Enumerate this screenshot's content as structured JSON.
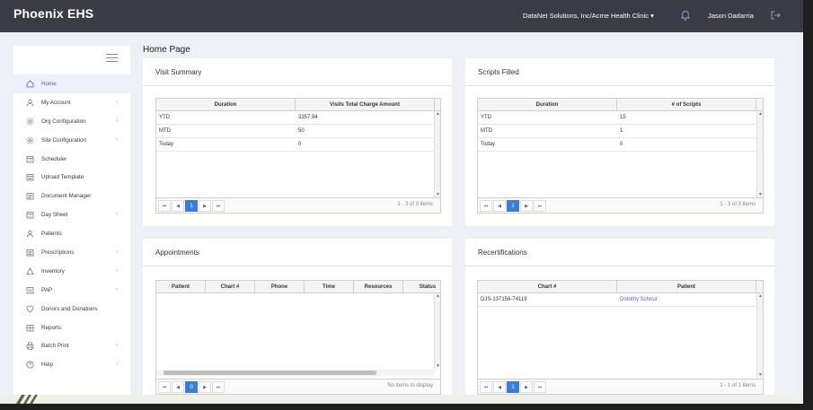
{
  "topbar": {
    "brand": "Phoenix EHS",
    "clinic": "DataNet Solutions, Inc/Acme Health Clinic",
    "user": "Jason Dadarria"
  },
  "sidebar": {
    "items": [
      {
        "label": "Home",
        "icon": "home-icon",
        "chevron": false,
        "active": true
      },
      {
        "label": "My Account",
        "icon": "user-icon",
        "chevron": true
      },
      {
        "label": "Org Configuration",
        "icon": "gear-icon",
        "chevron": true
      },
      {
        "label": "Site Configuration",
        "icon": "gear-icon",
        "chevron": true
      },
      {
        "label": "Scheduler",
        "icon": "calendar-icon",
        "chevron": false
      },
      {
        "label": "Upload Template",
        "icon": "upload-icon",
        "chevron": false
      },
      {
        "label": "Document Manager",
        "icon": "document-icon",
        "chevron": false
      },
      {
        "label": "Day Sheet",
        "icon": "calendar-icon",
        "chevron": true
      },
      {
        "label": "Patients",
        "icon": "patients-icon",
        "chevron": false
      },
      {
        "label": "Prescriptions",
        "icon": "prescription-icon",
        "chevron": true
      },
      {
        "label": "Inventory",
        "icon": "inventory-icon",
        "chevron": true
      },
      {
        "label": "PAP",
        "icon": "pap-icon",
        "chevron": true
      },
      {
        "label": "Donors and Donations",
        "icon": "donation-icon",
        "chevron": false
      },
      {
        "label": "Reports",
        "icon": "reports-icon",
        "chevron": false
      },
      {
        "label": "Batch Print",
        "icon": "print-icon",
        "chevron": true
      },
      {
        "label": "Help",
        "icon": "help-icon",
        "chevron": true
      }
    ]
  },
  "page": {
    "title": "Home Page"
  },
  "visit_summary": {
    "title": "Visit Summary",
    "columns": [
      "Duration",
      "Visits Total Charge Amount"
    ],
    "rows": [
      [
        "YTD",
        "3357.94"
      ],
      [
        "MTD",
        "50"
      ],
      [
        "Today",
        "0"
      ]
    ],
    "page": "1",
    "info": "1 - 3 of 3 items"
  },
  "scripts_filled": {
    "title": "Scripts Filled",
    "columns": [
      "Duration",
      "# of Scripts"
    ],
    "rows": [
      [
        "YTD",
        "15"
      ],
      [
        "MTD",
        "1"
      ],
      [
        "Today",
        "0"
      ]
    ],
    "page": "1",
    "info": "1 - 3 of 3 items"
  },
  "appointments": {
    "title": "Appointments",
    "columns": [
      "Patient",
      "Chart #",
      "Phone",
      "Time",
      "Resources",
      "Status"
    ],
    "page": "0",
    "info": "No items to display"
  },
  "recertifications": {
    "title": "Recertifications",
    "columns": [
      "Chart #",
      "Patient"
    ],
    "rows": [
      [
        "DJS-137156-74119",
        "Dorothy Schnur"
      ]
    ],
    "page": "1",
    "info": "1 - 1 of 1 items"
  },
  "pager_icons": [
    "first-page-icon",
    "prev-page-icon",
    "next-page-icon",
    "last-page-icon"
  ],
  "colors": {
    "topbar": "#3b3b46",
    "accent": "#3a7dd6",
    "link": "#4a60c8"
  }
}
